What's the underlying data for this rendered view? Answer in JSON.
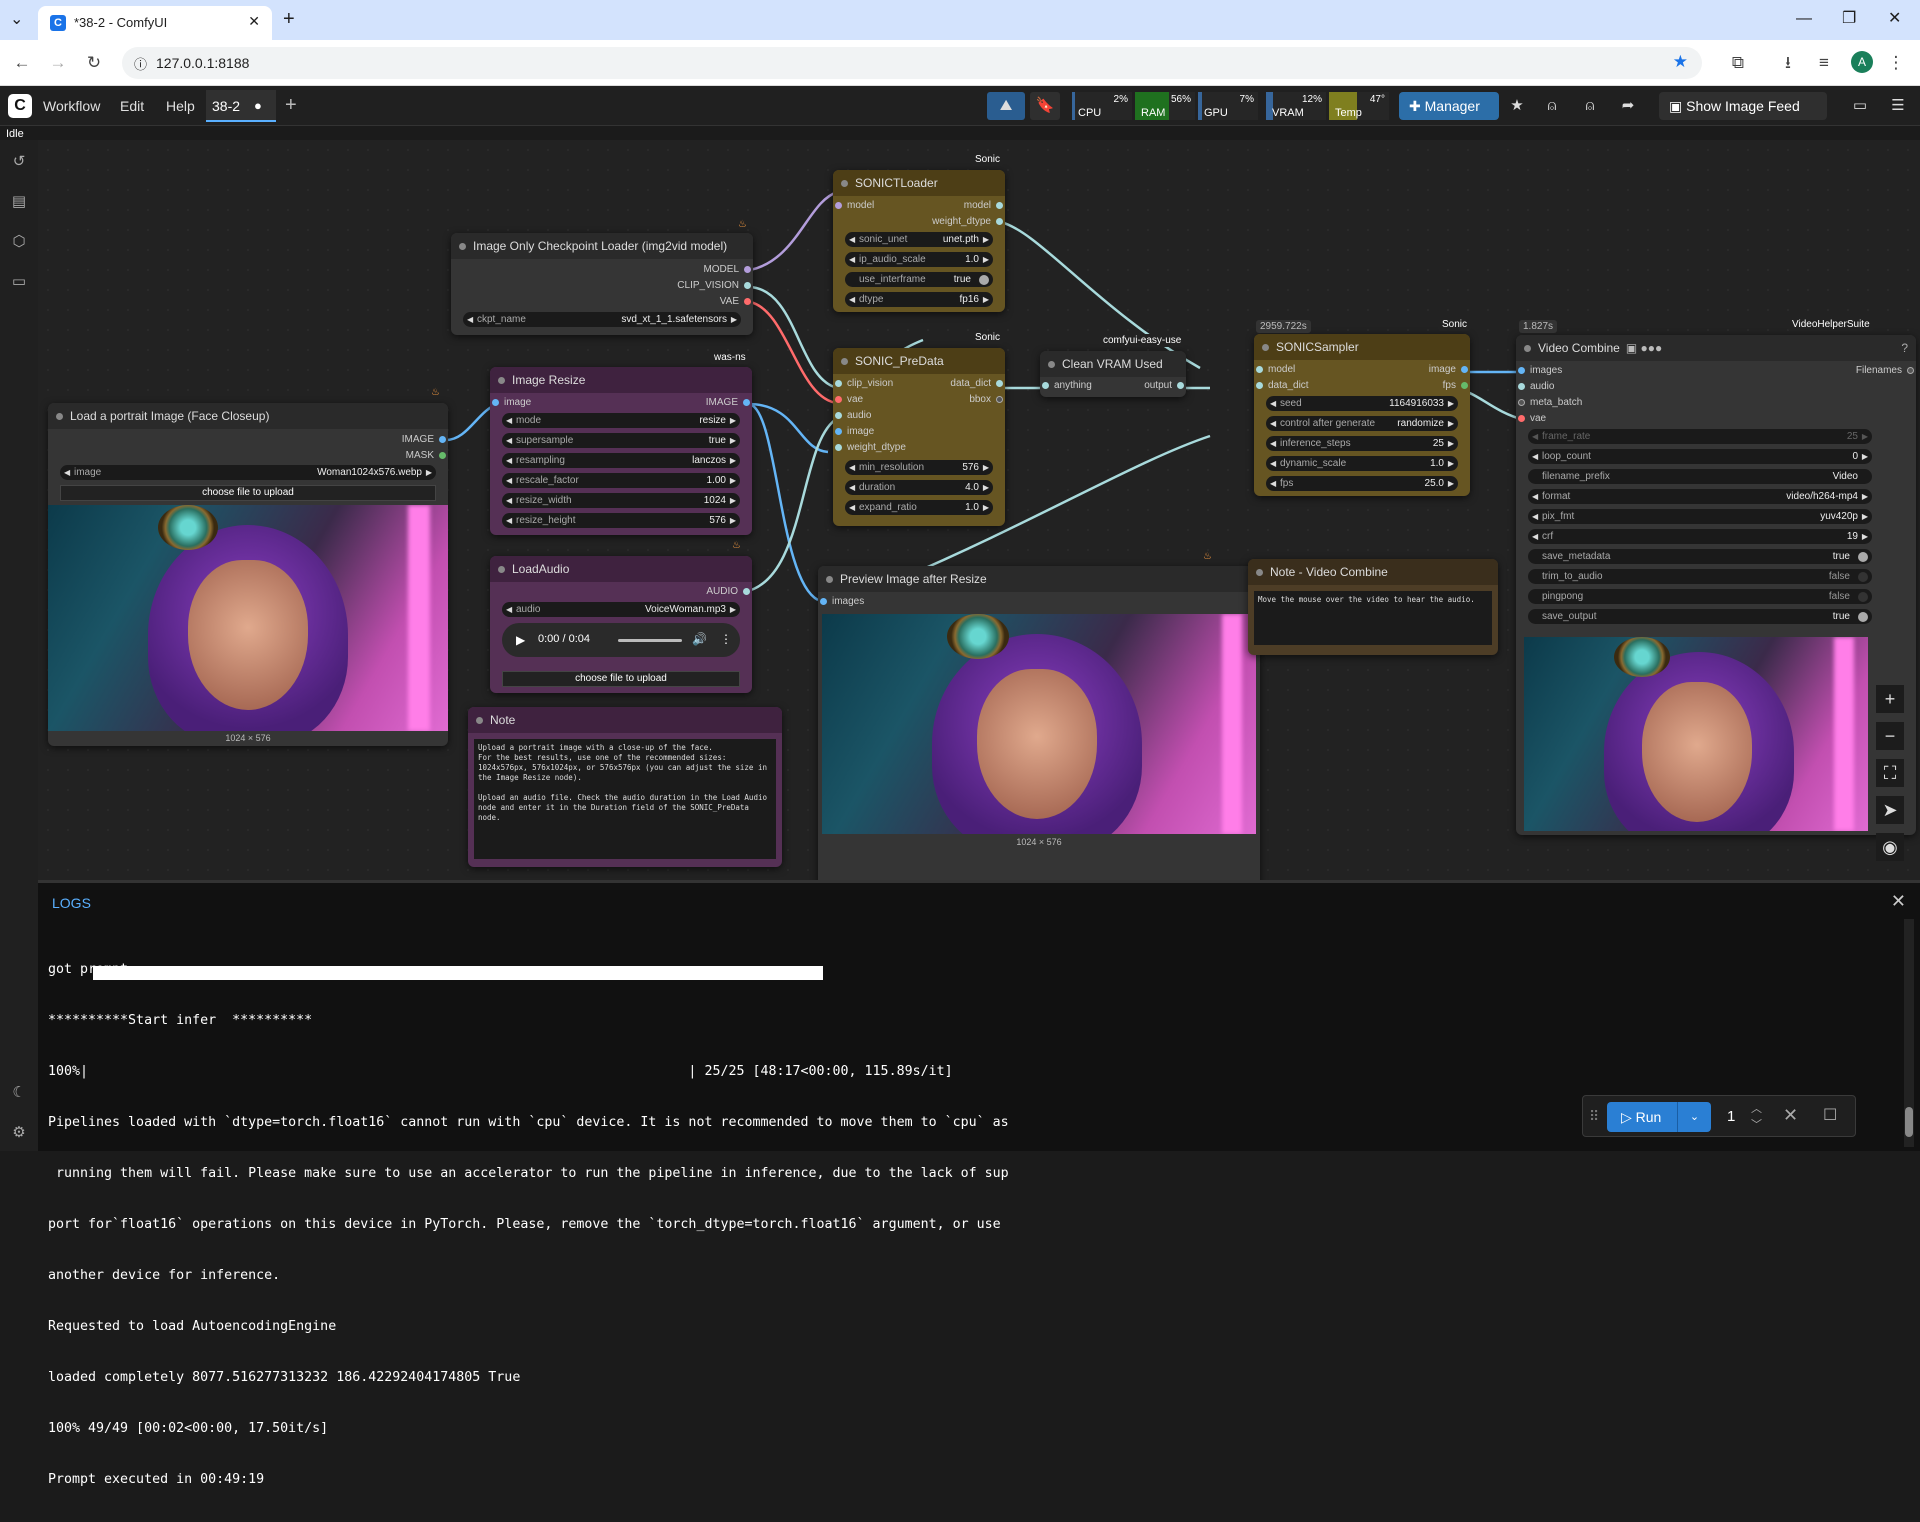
{
  "browser": {
    "tab_title": "*38-2 - ComfyUI",
    "url": "127.0.0.1:8188",
    "avatar_letter": "A"
  },
  "menubar": {
    "items": [
      "Workflow",
      "Edit",
      "Help"
    ],
    "workflow_tab": "38-2",
    "manager_label": "Manager",
    "image_feed_label": "Show Image Feed"
  },
  "monitors": [
    {
      "label": "CPU",
      "value": "2%",
      "color": "#3a6ea8"
    },
    {
      "label": "RAM",
      "value": "56%",
      "color": "#1f7a1f"
    },
    {
      "label": "GPU",
      "value": "7%",
      "color": "#3a6ea8"
    },
    {
      "label": "VRAM",
      "value": "12%",
      "color": "#3a6ea8"
    },
    {
      "label": "Temp",
      "value": "47°",
      "color": "#8a8a1f"
    }
  ],
  "status": "Idle",
  "nodes": {
    "load_image": {
      "title": "Load a portrait Image (Face Closeup)",
      "outputs": [
        "IMAGE",
        "MASK"
      ],
      "widget_label": "image",
      "widget_value": "Woman1024x576.webp",
      "upload": "choose file to upload",
      "caption": "1024 × 576"
    },
    "checkpoint": {
      "title": "Image Only Checkpoint Loader (img2vid model)",
      "outputs": [
        "MODEL",
        "CLIP_VISION",
        "VAE"
      ],
      "widget_label": "ckpt_name",
      "widget_value": "svd_xt_1_1.safetensors"
    },
    "image_resize": {
      "title": "Image Resize",
      "badge": "was-ns",
      "input": "image",
      "output": "IMAGE",
      "widgets": [
        {
          "k": "mode",
          "v": "resize"
        },
        {
          "k": "supersample",
          "v": "true"
        },
        {
          "k": "resampling",
          "v": "lanczos"
        },
        {
          "k": "rescale_factor",
          "v": "1.00"
        },
        {
          "k": "resize_width",
          "v": "1024"
        },
        {
          "k": "resize_height",
          "v": "576"
        }
      ]
    },
    "load_audio": {
      "title": "LoadAudio",
      "output": "AUDIO",
      "widget_label": "audio",
      "widget_value": "VoiceWoman.mp3",
      "time": "0:00 / 0:04",
      "upload": "choose file to upload"
    },
    "note": {
      "title": "Note",
      "text": "Upload a portrait image with a close-up of the face.\nFor the best results, use one of the recommended sizes:\n1024x576px, 576x1024px, or 576x576px (you can adjust the size in\nthe Image Resize node).\n\nUpload an audio file. Check the audio duration in the Load Audio\nnode and enter it in the Duration field of the SONIC_PreData\nnode."
    },
    "sonic_loader": {
      "title": "SONICTLoader",
      "badge": "Sonic",
      "input": "model",
      "outputs": [
        "model",
        "weight_dtype"
      ],
      "widgets": [
        {
          "k": "sonic_unet",
          "v": "unet.pth"
        },
        {
          "k": "ip_audio_scale",
          "v": "1.0"
        },
        {
          "k": "use_interframe",
          "v": "true"
        },
        {
          "k": "dtype",
          "v": "fp16"
        }
      ]
    },
    "sonic_predata": {
      "title": "SONIC_PreData",
      "badge": "Sonic",
      "inputs": [
        "clip_vision",
        "vae",
        "audio",
        "image",
        "weight_dtype"
      ],
      "outputs": [
        "data_dict",
        "bbox"
      ],
      "widgets": [
        {
          "k": "min_resolution",
          "v": "576"
        },
        {
          "k": "duration",
          "v": "4.0"
        },
        {
          "k": "expand_ratio",
          "v": "1.0"
        }
      ]
    },
    "clean_vram": {
      "title": "Clean VRAM Used",
      "badge": "comfyui-easy-use",
      "input": "anything",
      "output": "output"
    },
    "preview": {
      "title": "Preview Image after Resize",
      "input": "images",
      "caption": "1024 × 576"
    },
    "sonic_sampler": {
      "title": "SONICSampler",
      "badge": "Sonic",
      "timer": "2959.722s",
      "inputs": [
        "model",
        "data_dict"
      ],
      "outputs": [
        "image",
        "fps"
      ],
      "widgets": [
        {
          "k": "seed",
          "v": "1164916033"
        },
        {
          "k": "control after generate",
          "v": "randomize"
        },
        {
          "k": "inference_steps",
          "v": "25"
        },
        {
          "k": "dynamic_scale",
          "v": "1.0"
        },
        {
          "k": "fps",
          "v": "25.0"
        }
      ]
    },
    "note_video": {
      "title": "Note - Video Combine",
      "text": "Move the mouse over the video to hear the audio."
    },
    "video_combine": {
      "title": "Video Combine",
      "badge": "VideoHelperSuite",
      "timer": "1.827s",
      "inputs": [
        "images",
        "audio",
        "meta_batch",
        "vae"
      ],
      "output": "Filenames",
      "widgets": [
        {
          "k": "frame_rate",
          "v": "25"
        },
        {
          "k": "loop_count",
          "v": "0"
        },
        {
          "k": "filename_prefix",
          "v": "Video"
        },
        {
          "k": "format",
          "v": "video/h264-mp4"
        },
        {
          "k": "pix_fmt",
          "v": "yuv420p"
        },
        {
          "k": "crf",
          "v": "19"
        },
        {
          "k": "save_metadata",
          "v": "true"
        },
        {
          "k": "trim_to_audio",
          "v": "false"
        },
        {
          "k": "pingpong",
          "v": "false"
        },
        {
          "k": "save_output",
          "v": "true"
        }
      ]
    }
  },
  "logs": {
    "title": "LOGS",
    "progress_percent": 100,
    "lines": [
      "got prompt",
      "**********Start infer  **********",
      "100%|                                                                           | 25/25 [48:17<00:00, 115.89s/it]",
      "Pipelines loaded with `dtype=torch.float16` cannot run with `cpu` device. It is not recommended to move them to `cpu` as",
      " running them will fail. Please make sure to use an accelerator to run the pipeline in inference, due to the lack of sup",
      "port for`float16` operations on this device in PyTorch. Please, remove the `torch_dtype=torch.float16` argument, or use",
      "another device for inference.",
      "Requested to load AutoencodingEngine",
      "loaded completely 8077.516277313232 186.42292404174805 True",
      "100% 49/49 [00:02<00:00, 17.50it/s]",
      "Prompt executed in 00:49:19"
    ]
  },
  "runbar": {
    "run_label": "Run",
    "batch_count": "1"
  }
}
